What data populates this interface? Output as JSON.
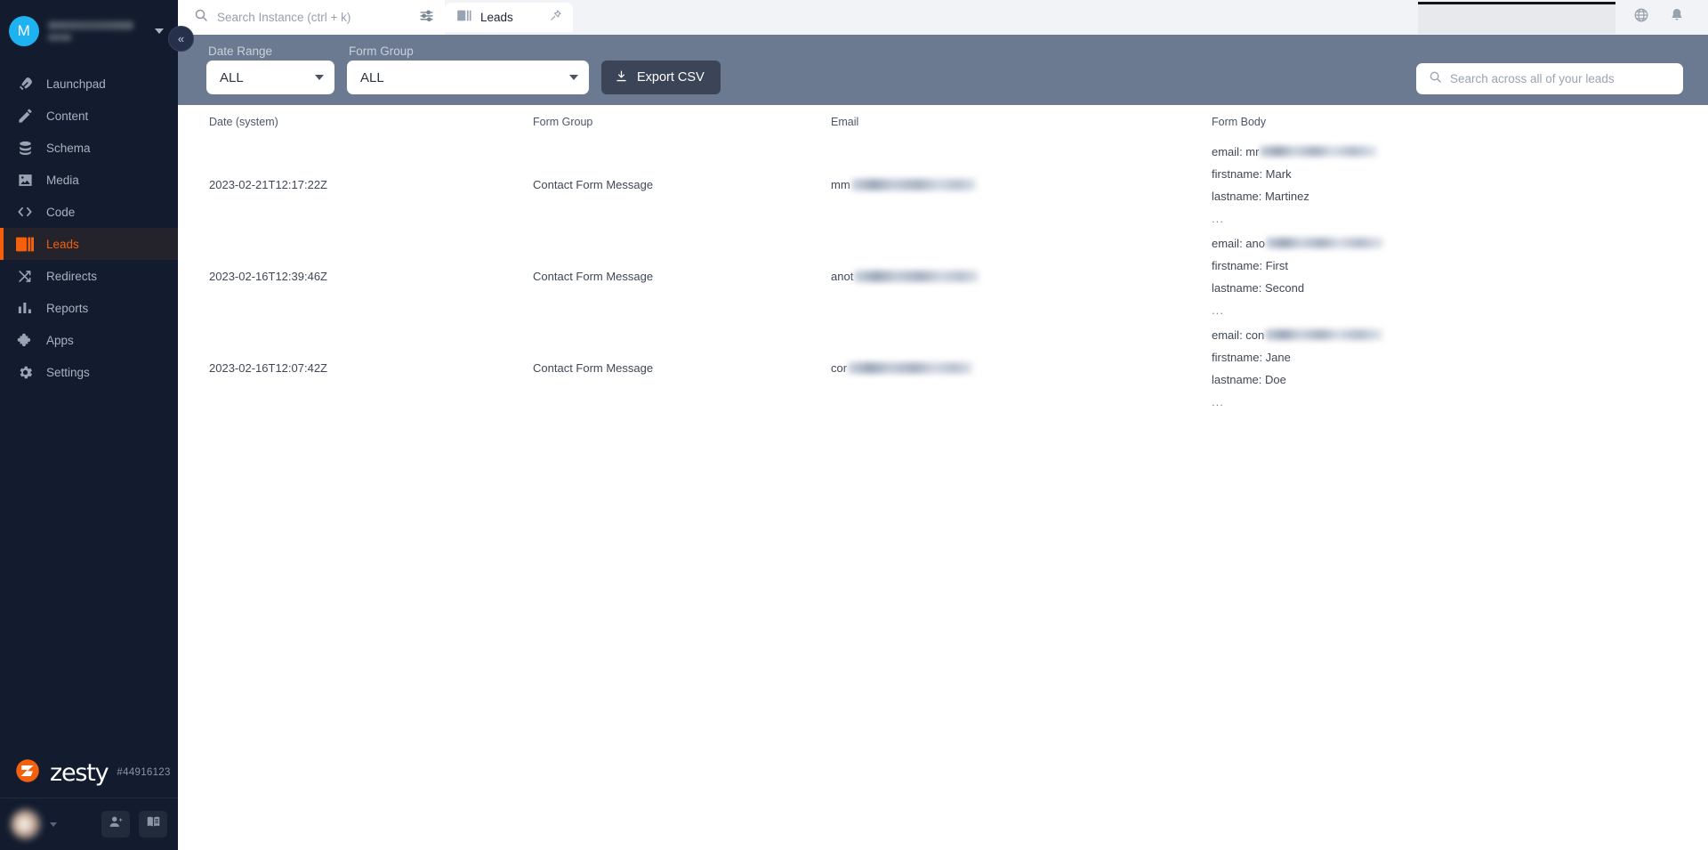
{
  "sidebar": {
    "avatar_initial": "M",
    "account_name_redacted": true,
    "items": [
      {
        "label": "Launchpad",
        "icon": "rocket-icon",
        "active": false
      },
      {
        "label": "Content",
        "icon": "pencil-icon",
        "active": false
      },
      {
        "label": "Schema",
        "icon": "database-icon",
        "active": false
      },
      {
        "label": "Media",
        "icon": "image-icon",
        "active": false
      },
      {
        "label": "Code",
        "icon": "code-brackets-icon",
        "active": false
      },
      {
        "label": "Leads",
        "icon": "contact-card-icon",
        "active": true
      },
      {
        "label": "Redirects",
        "icon": "shuffle-icon",
        "active": false
      },
      {
        "label": "Reports",
        "icon": "bar-chart-icon",
        "active": false
      },
      {
        "label": "Apps",
        "icon": "puzzle-icon",
        "active": false
      },
      {
        "label": "Settings",
        "icon": "gear-icon",
        "active": false
      }
    ],
    "brand": "zesty",
    "instance_id": "#44916123",
    "bottom_buttons": [
      "invite-user-icon",
      "docs-book-icon"
    ],
    "collapse_icon": "«",
    "active_color": "#f4600d",
    "background": "#131c2e"
  },
  "topbar": {
    "search_placeholder": "Search Instance (ctrl + k)",
    "search_value": "",
    "tabs": [
      {
        "label": "Leads",
        "icon": "contact-card-icon",
        "pinned": true
      }
    ],
    "right_icons": [
      "globe-icon",
      "bell-icon"
    ]
  },
  "filters": {
    "date_range": {
      "label": "Date Range",
      "value": "ALL"
    },
    "form_group": {
      "label": "Form Group",
      "value": "ALL"
    },
    "export_button": "Export CSV",
    "search": {
      "placeholder": "Search across all of your leads",
      "value": ""
    },
    "bar_color": "#6b7a91"
  },
  "table": {
    "columns": [
      "Date (system)",
      "Form Group",
      "Email",
      "Form Body"
    ],
    "rows": [
      {
        "date": "2023-02-21T12:17:22Z",
        "form_group": "Contact Form Message",
        "email_prefix": "mm",
        "email_redacted": true,
        "body": {
          "email_label": "email: mr",
          "email_redacted": true,
          "firstname": "firstname: Mark",
          "lastname": "lastname: Martinez",
          "more": "..."
        }
      },
      {
        "date": "2023-02-16T12:39:46Z",
        "form_group": "Contact Form Message",
        "email_prefix": "anot",
        "email_redacted": true,
        "body": {
          "email_label": "email: ano",
          "email_redacted": true,
          "firstname": "firstname: First",
          "lastname": "lastname: Second",
          "more": "..."
        }
      },
      {
        "date": "2023-02-16T12:07:42Z",
        "form_group": "Contact Form Message",
        "email_prefix": "cor",
        "email_redacted": true,
        "body": {
          "email_label": "email: con",
          "email_redacted": true,
          "firstname": "firstname: Jane",
          "lastname": "lastname: Doe",
          "more": "..."
        }
      }
    ]
  }
}
